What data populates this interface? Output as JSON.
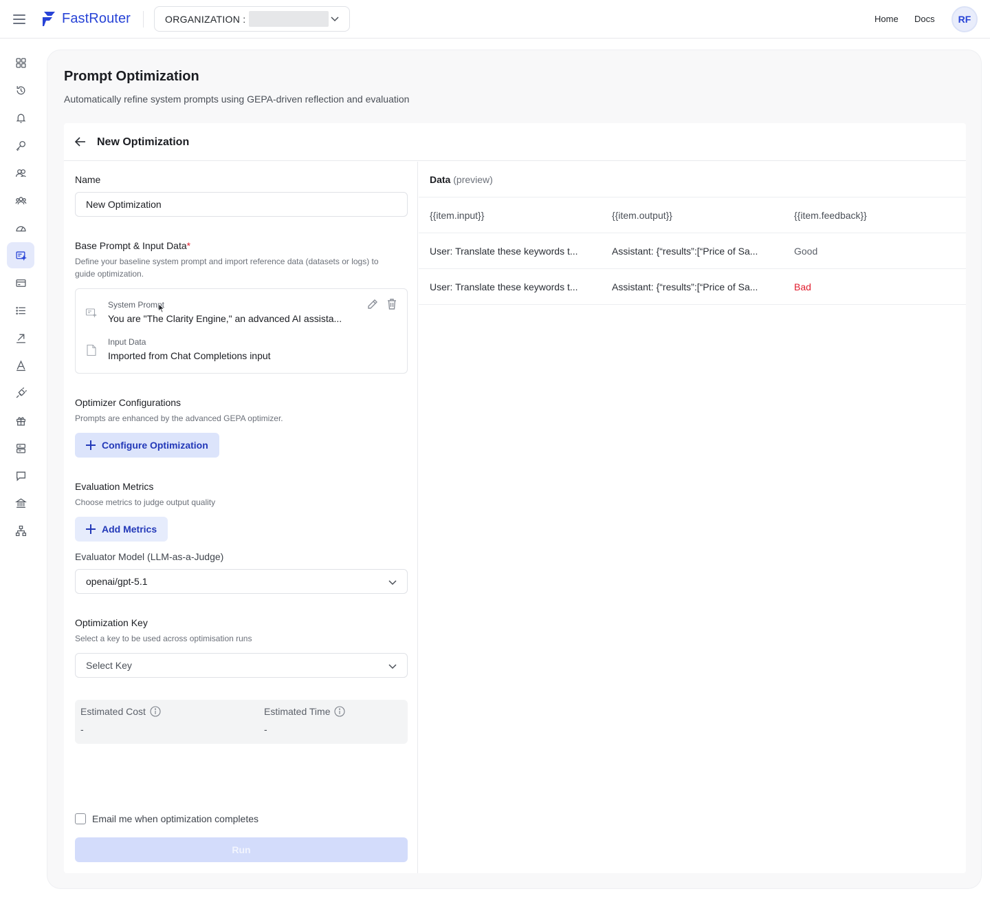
{
  "header": {
    "brand": "FastRouter",
    "org_label": "ORGANIZATION :",
    "nav": {
      "home": "Home",
      "docs": "Docs"
    },
    "avatar_initials": "RF"
  },
  "sidebar": {
    "items": [
      {
        "icon": "dashboard-icon"
      },
      {
        "icon": "history-icon"
      },
      {
        "icon": "bell-icon"
      },
      {
        "icon": "key-icon"
      },
      {
        "icon": "users-icon"
      },
      {
        "icon": "team-icon"
      },
      {
        "icon": "gauge-icon"
      },
      {
        "icon": "prompt-optimization-icon",
        "active": true
      },
      {
        "icon": "credit-card-icon"
      },
      {
        "icon": "list-icon"
      },
      {
        "icon": "arrow-up-right-icon"
      },
      {
        "icon": "text-icon"
      },
      {
        "icon": "plug-icon"
      },
      {
        "icon": "gift-icon"
      },
      {
        "icon": "server-icon"
      },
      {
        "icon": "chat-icon"
      },
      {
        "icon": "bank-icon"
      },
      {
        "icon": "network-icon"
      }
    ]
  },
  "page": {
    "title": "Prompt Optimization",
    "subtitle": "Automatically refine system prompts using GEPA-driven reflection and evaluation"
  },
  "panel": {
    "title": "New Optimization"
  },
  "form": {
    "name_label": "Name",
    "name_value": "New Optimization",
    "base_label": "Base Prompt & Input Data",
    "base_required": "*",
    "base_hint_1": "Define your baseline system prompt and import reference data (datasets or logs) to",
    "base_hint_2": "guide optimization.",
    "system_prompt_label": "System Prompt",
    "system_prompt_value": "You are \"The Clarity Engine,\" an advanced AI assista...",
    "input_data_label": "Input Data",
    "input_data_value": "Imported from Chat Completions input",
    "optimizer_label": "Optimizer Configurations",
    "optimizer_hint": "Prompts are enhanced by the advanced GEPA optimizer.",
    "configure_button": "Configure Optimization",
    "metrics_label": "Evaluation Metrics",
    "metrics_hint": "Choose metrics to judge output quality",
    "add_metrics_button": "Add Metrics",
    "evaluator_label": "Evaluator Model (LLM-as-a-Judge)",
    "evaluator_value": "openai/gpt-5.1",
    "key_label": "Optimization Key",
    "key_hint": "Select a key to be used across optimisation runs",
    "key_placeholder": "Select Key",
    "estimated_cost_label": "Estimated Cost",
    "estimated_cost_value": "-",
    "estimated_time_label": "Estimated Time",
    "estimated_time_value": "-",
    "email_label": "Email me when optimization completes",
    "run_button": "Run"
  },
  "preview": {
    "title": "Data",
    "title_suffix": "(preview)",
    "columns": [
      "{{item.input}}",
      "{{item.output}}",
      "{{item.feedback}}"
    ],
    "rows": [
      [
        "User: Translate these keywords t...",
        "Assistant: {“results”:[“Price of Sa...",
        "Good"
      ],
      [
        "User: Translate these keywords t...",
        "Assistant: {“results”:[“Price of Sa...",
        "Bad"
      ]
    ]
  },
  "colors": {
    "accent": "#2743d6",
    "active_bg": "#e4e9fb",
    "bad": "#e11d2e"
  }
}
